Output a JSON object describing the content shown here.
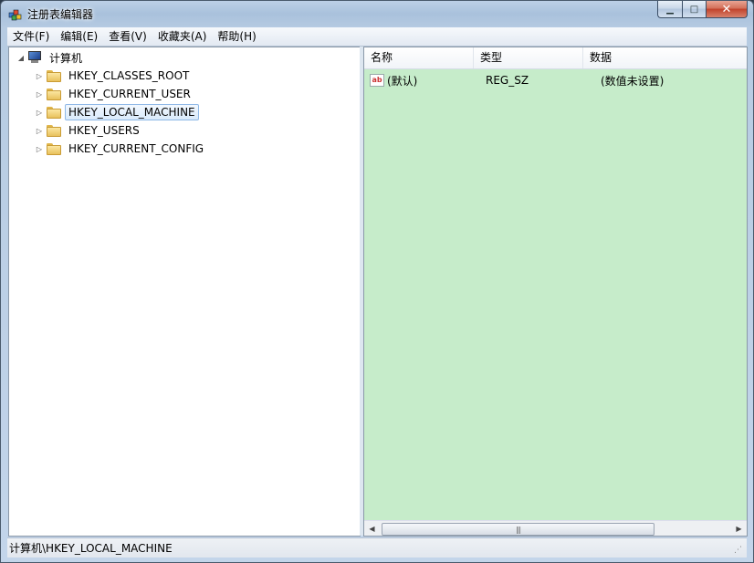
{
  "window": {
    "title": "注册表编辑器",
    "min_glyph": "▁",
    "max_glyph": "□",
    "close_glyph": "✕"
  },
  "menu": [
    {
      "label": "文件(F)"
    },
    {
      "label": "编辑(E)"
    },
    {
      "label": "查看(V)"
    },
    {
      "label": "收藏夹(A)"
    },
    {
      "label": "帮助(H)"
    }
  ],
  "tree": {
    "root": {
      "label": "计算机",
      "icon": "computer-icon",
      "expanded": true
    },
    "items": [
      {
        "label": "HKEY_CLASSES_ROOT",
        "icon": "folder-icon"
      },
      {
        "label": "HKEY_CURRENT_USER",
        "icon": "folder-icon"
      },
      {
        "label": "HKEY_LOCAL_MACHINE",
        "icon": "folder-icon",
        "selected": true
      },
      {
        "label": "HKEY_USERS",
        "icon": "folder-icon"
      },
      {
        "label": "HKEY_CURRENT_CONFIG",
        "icon": "folder-icon"
      }
    ]
  },
  "list": {
    "columns": [
      "名称",
      "类型",
      "数据"
    ],
    "rows": [
      {
        "name": "(默认)",
        "type": "REG_SZ",
        "data": "(数值未设置)",
        "icon": "string-value-icon",
        "icon_text": "ab"
      }
    ],
    "background_color": "#c6ecca"
  },
  "status": {
    "path": "计算机\\HKEY_LOCAL_MACHINE"
  }
}
